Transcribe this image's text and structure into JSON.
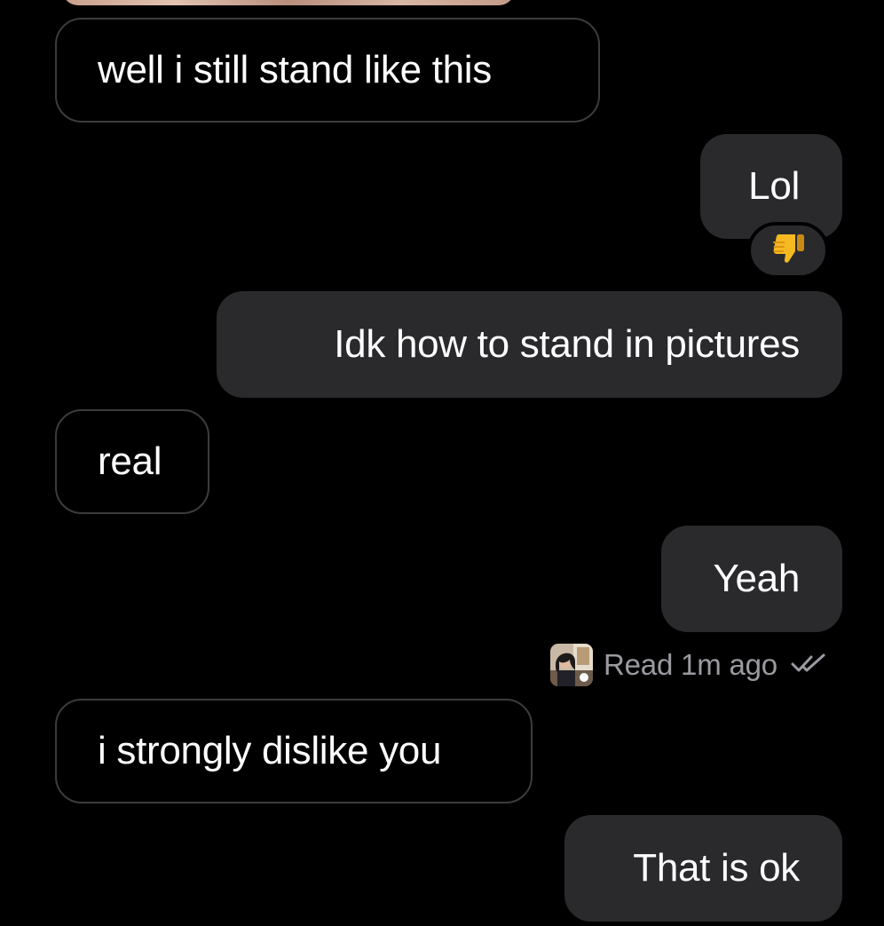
{
  "colors": {
    "background": "#000000",
    "incoming_border": "#3c3c3f",
    "outgoing_fill": "#2a2a2d",
    "read_receipt_text": "#9a9aa0"
  },
  "messages": [
    {
      "direction": "incoming",
      "text": "well i still stand like this"
    },
    {
      "direction": "outgoing",
      "text": "Lol",
      "reaction": "thumbs-down-emoji"
    },
    {
      "direction": "outgoing",
      "text": "Idk how to stand in pictures"
    },
    {
      "direction": "incoming",
      "text": "real"
    },
    {
      "direction": "outgoing",
      "text": "Yeah"
    },
    {
      "direction": "incoming",
      "text": "i strongly dislike you"
    },
    {
      "direction": "outgoing",
      "text": "That is ok"
    }
  ],
  "read_receipt": {
    "text": "Read 1m ago",
    "avatar": "contact-avatar-photo",
    "icon": "double-check-icon"
  }
}
